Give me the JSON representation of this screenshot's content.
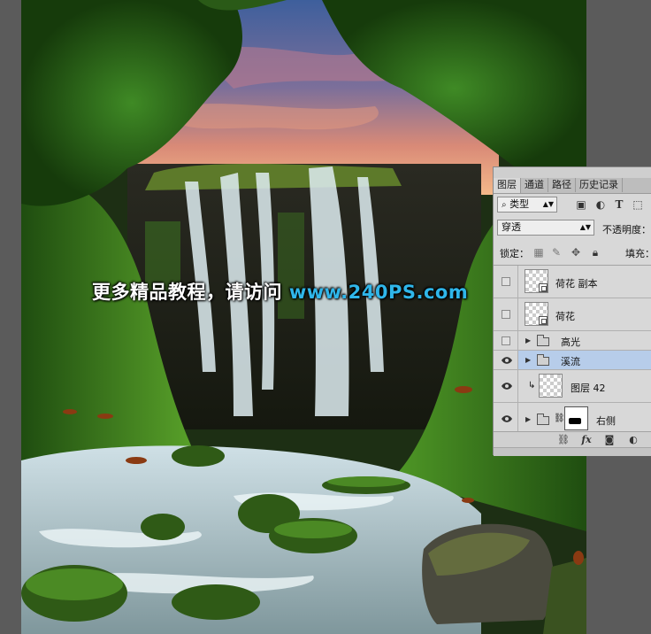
{
  "watermark": {
    "text": "更多精品教程，请访问 ",
    "url": "www.240PS.com"
  },
  "layers_panel": {
    "tabs": [
      {
        "label": "图层",
        "active": true
      },
      {
        "label": "通道",
        "active": false
      },
      {
        "label": "路径",
        "active": false
      },
      {
        "label": "历史记录",
        "active": false
      }
    ],
    "filter_kind": "类型",
    "blend_mode": "穿透",
    "opacity_label": "不透明度：",
    "lock_label": "锁定：",
    "fill_label": "填充：",
    "layers": [
      {
        "name": "荷花 副本",
        "visible": false,
        "kind": "smart-object",
        "selected": false
      },
      {
        "name": "荷花",
        "visible": false,
        "kind": "smart-object",
        "selected": false
      },
      {
        "name": "高光",
        "visible": false,
        "kind": "group",
        "selected": false
      },
      {
        "name": "溪流",
        "visible": true,
        "kind": "group",
        "selected": true
      },
      {
        "name": "图层 42",
        "visible": true,
        "kind": "clipped-layer",
        "selected": false
      },
      {
        "name": "右侧",
        "visible": true,
        "kind": "group-with-mask",
        "selected": false
      }
    ],
    "footer_icons": [
      "link-icon",
      "fx-icon",
      "mask-icon",
      "adjustment-icon"
    ]
  },
  "colors": {
    "watermark_text": "#ffffff",
    "watermark_url": "#2fb6ea",
    "selected_layer": "#b7cdea",
    "panel_bg": "#d8d8d8"
  }
}
